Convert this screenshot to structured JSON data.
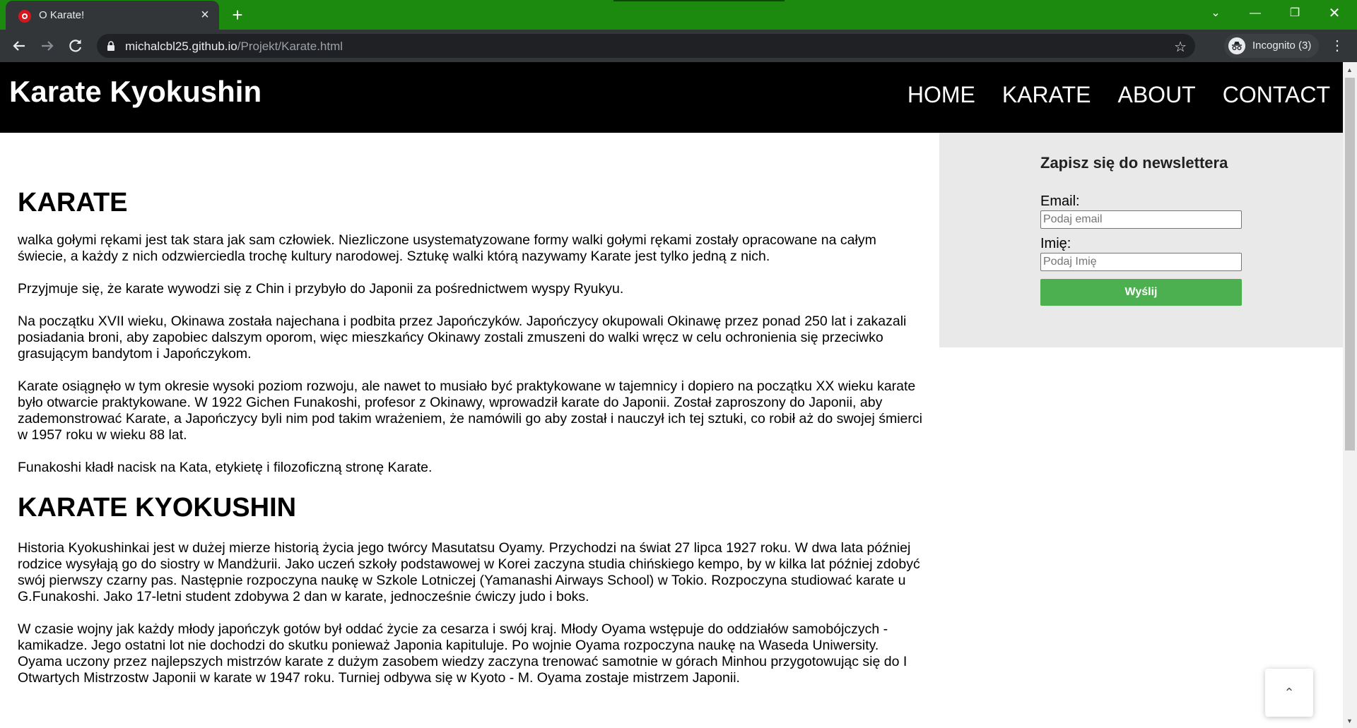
{
  "browser": {
    "tab_title": "O Karate!",
    "url_host": "michalcbl25.github.io",
    "url_path": "/Projekt/Karate.html",
    "incognito_label": "Incognito (3)",
    "accent_color": "#1b8a0f"
  },
  "header": {
    "brand": "Karate Kyokushin",
    "nav": [
      "HOME",
      "KARATE",
      "ABOUT",
      "CONTACT"
    ]
  },
  "article": {
    "section1_title": "KARATE",
    "section1_paragraphs": [
      "walka gołymi rękami jest tak stara jak sam człowiek. Niezliczone usystematyzowane formy walki gołymi rękami zostały opracowane na całym świecie, a każdy z nich odzwierciedla trochę kultury narodowej. Sztukę walki którą nazywamy Karate jest tylko jedną z nich.",
      "Przyjmuje się, że karate wywodzi się z Chin i przybyło do Japonii za pośrednictwem wyspy Ryukyu.",
      "Na początku XVII wieku, Okinawa została najechana i podbita przez Japończyków. Japończycy okupowali Okinawę przez ponad 250 lat i zakazali posiadania broni, aby zapobiec dalszym oporom, więc mieszkańcy Okinawy zostali zmuszeni do walki wręcz w celu ochronienia się przeciwko grasującym bandytom i Japończykom.",
      "Karate osiągnęło w tym okresie wysoki poziom rozwoju, ale nawet to musiało być praktykowane w tajemnicy i dopiero na początku XX wieku karate było otwarcie praktykowane. W 1922 Gichen Funakoshi, profesor z Okinawy, wprowadził karate do Japonii. Został zaproszony do Japonii, aby zademonstrować Karate, a Japończycy byli nim pod takim wrażeniem, że namówili go aby został i nauczył ich tej sztuki, co robił aż do swojej śmierci w 1957 roku w wieku 88 lat.",
      "Funakoshi kładł nacisk na Kata, etykietę i filozoficzną stronę Karate."
    ],
    "section2_title": "KARATE KYOKUSHIN",
    "section2_paragraphs": [
      "Historia Kyokushinkai jest w dużej mierze historią życia jego twórcy Masutatsu Oyamy. Przychodzi na świat 27 lipca 1927 roku. W dwa lata później rodzice wysyłają go do siostry w Mandżurii. Jako uczeń szkoły podstawowej w Korei zaczyna studia chińskiego kempo, by w kilka lat później zdobyć swój pierwszy czarny pas. Następnie rozpoczyna naukę w Szkole Lotniczej (Yamanashi Airways School) w Tokio. Rozpoczyna studiować karate u G.Funakoshi. Jako 17-letni student zdobywa 2 dan w karate, jednocześnie ćwiczy judo i boks.",
      "W czasie wojny jak każdy młody japończyk gotów był oddać życie za cesarza i swój kraj. Młody Oyama wstępuje do oddziałów samobójczych - kamikadze. Jego ostatni lot nie dochodzi do skutku ponieważ Japonia kapituluje. Po wojnie Oyama rozpoczyna naukę na Waseda Uniwersity. Oyama uczony przez najlepszych mistrzów karate z dużym zasobem wiedzy zaczyna trenować samotnie w górach Minhou przygotowując się do I Otwartych Mistrzostw Japonii w karate w 1947 roku. Turniej odbywa się w Kyoto - M. Oyama zostaje mistrzem Japonii."
    ]
  },
  "newsletter": {
    "title": "Zapisz się do newslettera",
    "email_label": "Email:",
    "email_placeholder": "Podaj email",
    "name_label": "Imię:",
    "name_placeholder": "Podaj Imię",
    "submit_label": "Wyślij",
    "button_color": "#4caf50"
  },
  "icons": {
    "back_to_top": "chevron-up-icon"
  }
}
